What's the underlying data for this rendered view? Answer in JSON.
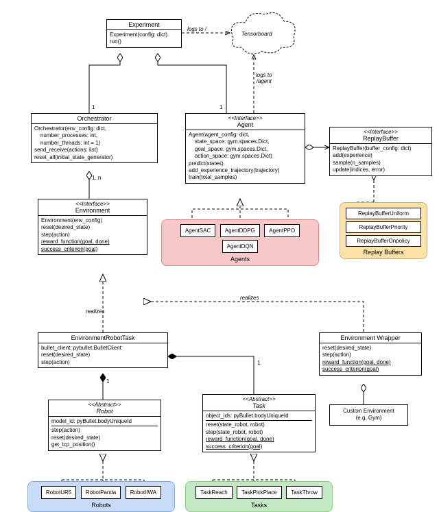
{
  "experiment": {
    "title": "Experiment",
    "body1": "Experiment(config: dict)",
    "body2": "run()"
  },
  "tensorboard": "Tensorboard",
  "edge_logs_tb": "logs to /",
  "edge_logs_agent": "logs to\n/agent",
  "orchestrator": {
    "title": "Orchestrator",
    "l1": "Orchestrator(env_config: dict,",
    "l2": "    number_processes: int,",
    "l3": "    number_threads: int = 1)",
    "l4": "send_receive(actions: list)",
    "l5": "reset_all(initial_state_generator)"
  },
  "agent_iface": {
    "stereo": "<<Interface>>",
    "title": "Agent",
    "l1": "Agent(agent_config: dict,",
    "l2": "    state_space: gym.spaces.Dict,",
    "l3": "    goal_space: gym.spaces.Dict,",
    "l4": "    action_space: gym.spaces.Dict)",
    "l5": "predict(states)",
    "l6": "add_experience_trajectory(trajectory)",
    "l7": "train(total_samples)"
  },
  "replaybuf_iface": {
    "stereo": "<<Interface>>",
    "title": "ReplayBuffer",
    "l1": "ReplayBuffer(buffer_config: dict)",
    "l2": "add(experience)",
    "l3": "sample(n_samples)",
    "l4": "update(indices, error)"
  },
  "environment_iface": {
    "stereo": "<<Interface>>",
    "title": "Environment",
    "l1": "Environment(env_config)",
    "l2": "reset(desired_state)",
    "l3": "step(action)",
    "l4": "reward_function(goal, done)",
    "l5": "success_criterion(goal)"
  },
  "agents": {
    "label": "Agents",
    "a1": "AgentSAC",
    "a2": "AgentDDPG",
    "a3": "AgentPPO",
    "a4": "AgentDQN"
  },
  "buffers": {
    "label": "Replay Buffers",
    "b1": "ReplayBufferUniform",
    "b2": "ReplayBufferPriority",
    "b3": "ReplayBufferOnpolicy"
  },
  "env_robot_task": {
    "title": "EnvironmentRobotTask",
    "l1": "bullet_client: pybullet.BulletClient",
    "l2": "reset(desired_state)",
    "l3": "step(action)"
  },
  "env_wrapper": {
    "title": "Environment Wrapper",
    "l1": "reset(desired_state)",
    "l2": "step(action)",
    "l3": "reward_function(goal, done)",
    "l4": "success_criterion(goal)"
  },
  "custom_env": {
    "l1": "Custom Environment",
    "l2": "(e.g. Gym)"
  },
  "robot": {
    "stereo": "<<Abstract>>",
    "title": "Robot",
    "l1": "model_id: pyBullet.bodyUniqueId",
    "l2": "step(action)",
    "l3": "reset(desired_state)",
    "l4": "get_tcp_position()"
  },
  "task": {
    "stereo": "<<Abstract>>",
    "title": "Task",
    "l1": "object_ids: pyBullet.bodyUniqueId",
    "l2": "reset(state_robot, robot)",
    "l3": "step(state_robot, robot)",
    "l4": "reward_function(goal, done)",
    "l5": "success_criterion(goal)"
  },
  "robots": {
    "label": "Robots",
    "r1": "RobotUR5",
    "r2": "RobotPanda",
    "r3": "RobotIIWA"
  },
  "tasks": {
    "label": "Tasks",
    "t1": "TaskReach",
    "t2": "TaskPickPlace",
    "t3": "TaskThrow"
  },
  "realizes1": "realizes",
  "realizes2": "realizes",
  "one": "1",
  "one_n": "1..n"
}
